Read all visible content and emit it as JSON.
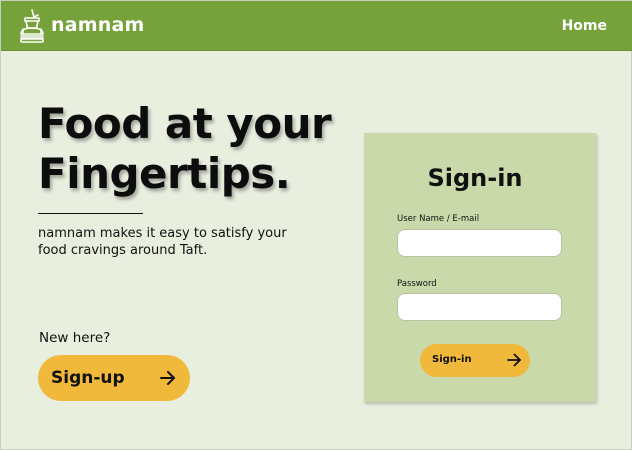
{
  "nav": {
    "brand": "namnam",
    "home_label": "Home",
    "logo_icon": "food-drink-icon"
  },
  "hero": {
    "title_line1": "Food at your",
    "title_line2": "Fingertips.",
    "tagline": "namnam makes it easy to satisfy your food cravings around Taft."
  },
  "signup": {
    "prompt": "New here?",
    "button_label": "Sign-up",
    "button_icon": "arrow-right-icon"
  },
  "signin": {
    "title": "Sign-in",
    "username_label": "User Name / E-mail",
    "username_value": "",
    "password_label": "Password",
    "password_value": "",
    "button_label": "Sign-in",
    "button_icon": "arrow-right-icon"
  },
  "colors": {
    "navbar": "#76a23b",
    "background": "#e8efdf",
    "card": "#cad9aa",
    "accent": "#f0b93c"
  }
}
